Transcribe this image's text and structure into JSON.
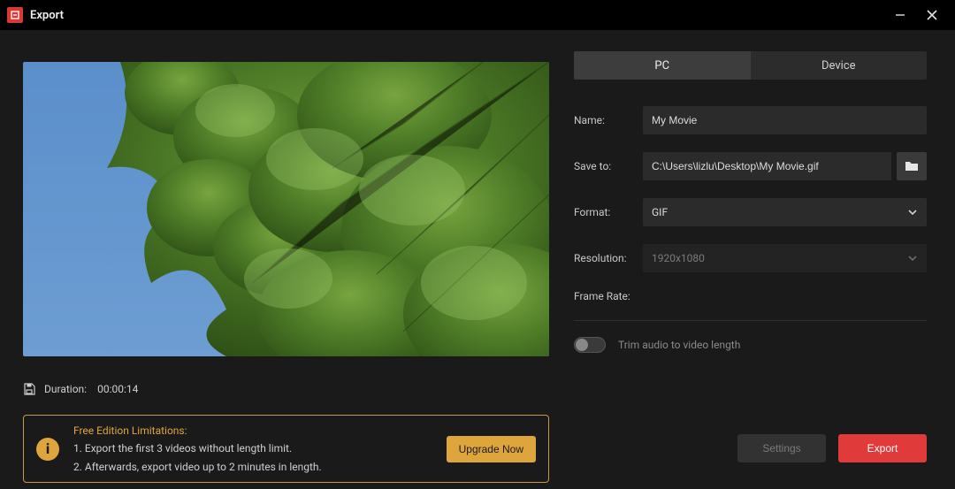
{
  "window": {
    "title": "Export"
  },
  "tabs": {
    "pc": "PC",
    "device": "Device",
    "active": "pc"
  },
  "fields": {
    "name_label": "Name:",
    "name_value": "My Movie",
    "saveto_label": "Save to:",
    "saveto_value": "C:\\Users\\lizlu\\Desktop\\My Movie.gif",
    "format_label": "Format:",
    "format_value": "GIF",
    "resolution_label": "Resolution:",
    "resolution_value": "1920x1080",
    "framerate_label": "Frame Rate:",
    "framerate_value": ""
  },
  "trim": {
    "label": "Trim audio to video length",
    "on": false
  },
  "meta": {
    "duration_label": "Duration:",
    "duration_value": "00:00:14"
  },
  "limits": {
    "title": "Free Edition Limitations:",
    "line1": "1. Export the first 3 videos without length limit.",
    "line2": "2. Afterwards, export video up to 2 minutes in length.",
    "upgrade_btn": "Upgrade Now"
  },
  "footer": {
    "settings": "Settings",
    "export": "Export"
  }
}
